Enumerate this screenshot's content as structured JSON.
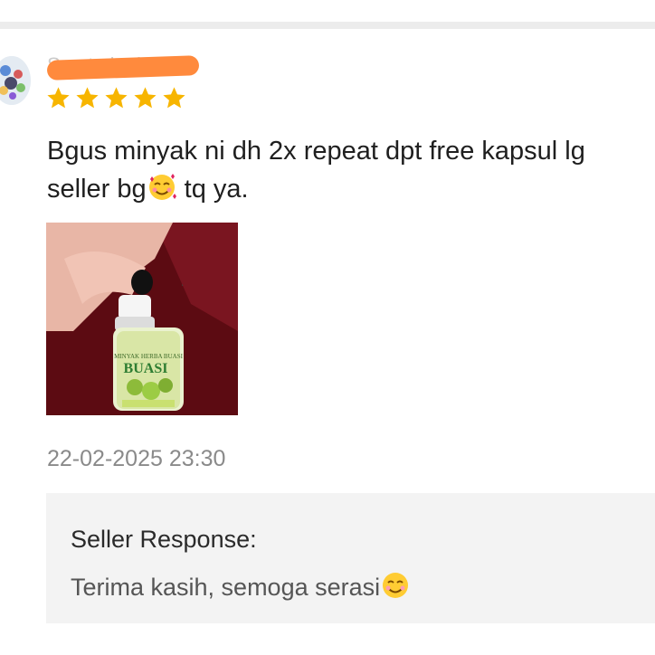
{
  "review": {
    "username": "S.....t...k.ah",
    "rating": 5,
    "rating_max": 5,
    "text_line1": "Bgus minyak ni dh 2x repeat dpt free kapsul lg",
    "text_line2_a": "seller bg",
    "text_line2_emoji": "smiling-face-with-hearts",
    "text_line2_b": " tq ya.",
    "photo_label": "MINYAK HERBA BUASI",
    "photo_label_big": "BUASI",
    "timestamp": "22-02-2025 23:30"
  },
  "seller_response": {
    "title": "Seller Response:",
    "reply": "Terima kasih, semoga serasi",
    "reply_emoji": "smiling-face"
  },
  "colors": {
    "star": "#f7b500",
    "redaction": "#ff8a3d",
    "seller_bg": "#f3f3f3",
    "timestamp": "#8a8a8a"
  }
}
